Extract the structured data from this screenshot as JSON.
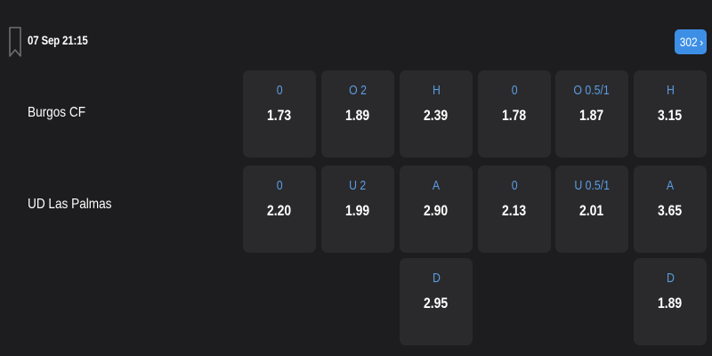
{
  "match": {
    "datetime": "07 Sep 21:15",
    "more_count": "302",
    "more_chevron": "›"
  },
  "teams": {
    "home": "Burgos CF",
    "away": "UD Las Palmas"
  },
  "icons": {
    "bookmark": "bookmark-icon",
    "more": "chevron-right-icon"
  },
  "colors": {
    "background": "#1d1d1f",
    "cell": "#2a2a2c",
    "label": "#5b9be0",
    "accent": "#3d8fe6"
  },
  "markets": {
    "home_row": [
      {
        "label": "0",
        "odds": "1.73"
      },
      {
        "label": "O 2",
        "odds": "1.89"
      },
      {
        "label": "H",
        "odds": "2.39"
      },
      {
        "label": "0",
        "odds": "1.78"
      },
      {
        "label": "O 0.5/1",
        "odds": "1.87"
      },
      {
        "label": "H",
        "odds": "3.15"
      }
    ],
    "away_row": [
      {
        "label": "0",
        "odds": "2.20"
      },
      {
        "label": "U 2",
        "odds": "1.99"
      },
      {
        "label": "A",
        "odds": "2.90"
      },
      {
        "label": "0",
        "odds": "2.13"
      },
      {
        "label": "U 0.5/1",
        "odds": "2.01"
      },
      {
        "label": "A",
        "odds": "3.65"
      }
    ],
    "draw_row": [
      {
        "label": "D",
        "odds": "2.95"
      },
      {
        "label": "D",
        "odds": "1.89"
      }
    ]
  }
}
